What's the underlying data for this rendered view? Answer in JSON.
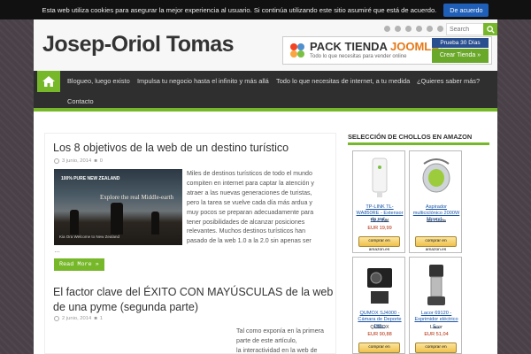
{
  "cookie_bar": {
    "message": "Esta web utiliza cookies para asegurar la mejor experiencia al usuario. Si continúa utilizando este sitio asumiré que está de acuerdo.",
    "accept_label": "De acuerdo"
  },
  "header": {
    "site_title": "Josep-Oriol Tomas",
    "search_placeholder": "Search"
  },
  "banner": {
    "title_main": "PACK TIENDA",
    "title_accent": "JOOMLA!",
    "subtitle": "Todo lo que necesitas para vender online",
    "trial": "Prueba 30 Días",
    "cta": "Crear Tienda »"
  },
  "nav": {
    "items": [
      "Blogueo, luego existo",
      "Impulsa tu negocio hasta el infinito y más allá",
      "Todo lo que necesitas de internet, a tu medida",
      "¿Quieres saber más?",
      "Contacto"
    ]
  },
  "posts": [
    {
      "title": "Los 8 objetivos de la web de un destino turístico",
      "date": "3 junio, 2014",
      "comments": "0",
      "image_brand": "100% PURE NEW ZEALAND",
      "image_caption": "Explore the real Middle-earth",
      "image_footer": "Kia Ora  Welcome to New Zealand",
      "excerpt": [
        "Miles de destinos turísticos de todo el mundo",
        "compiten en internet para captar la atención y",
        "atraer a las nuevas generaciones de turistas,",
        "pero la tarea se vuelve cada día más ardua y",
        "muy pocos se preparan adecuadamente para",
        "tener posibilidades de alcanzar posiciones",
        "relevantes. Muchos destinos turísticos han",
        "pasado de la web 1.0 a la 2.0 sin apenas ser",
        "…"
      ],
      "read_more": "Read More »"
    },
    {
      "title": "El factor clave del ÉXITO CON MAYÚSCULAS de la web de una pyme (segunda parte)",
      "date": "2 junio, 2014",
      "comments": "1",
      "excerpt": [
        "Tal como exponía en la primera",
        "parte de este artículo,",
        "la interactividad en la web de"
      ]
    }
  ],
  "sidebar": {
    "title": "SELECCIÓN DE CHOLLOS EN AMAZON",
    "products": [
      {
        "name": "TP-LINK TL-WA850RE - Extensor de red...",
        "brand": "TP-LINK",
        "price": "EUR 19,99",
        "buy": "comprar en amazon.es"
      },
      {
        "name": "Aspirador multiciclónico 2000W Mound...",
        "brand": "Mr Onda",
        "price": "",
        "buy": "comprar en amazon.es"
      },
      {
        "name": "QUMOX SJ4000 - Cámara de Deporte par...",
        "brand": "QUMOX",
        "price": "EUR 90,88",
        "buy": "comprar en amazon.es"
      },
      {
        "name": "Lacor 69120 - Exprimidor eléctrico c...",
        "brand": "Lacor",
        "price": "EUR 51,04",
        "buy": "comprar en amazon.es"
      }
    ]
  },
  "colors": {
    "accent_green": "#76b82a",
    "nav_background": "#2f2f2f",
    "page_background": "#4a4048",
    "cookie_button": "#1f5fb8"
  }
}
